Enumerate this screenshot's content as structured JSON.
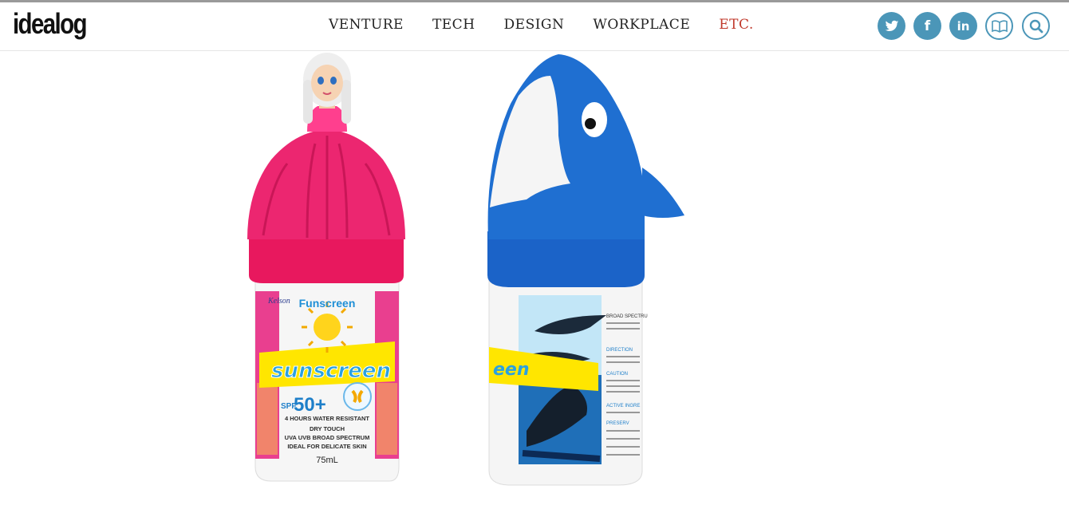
{
  "site": {
    "logo": "idealog"
  },
  "nav": {
    "items": [
      {
        "label": "VENTURE"
      },
      {
        "label": "TECH"
      },
      {
        "label": "DESIGN"
      },
      {
        "label": "WORKPLACE"
      },
      {
        "label": "ETC."
      }
    ],
    "active_index": 4
  },
  "social": [
    {
      "icon": "twitter-icon"
    },
    {
      "icon": "facebook-icon",
      "glyph": "f"
    },
    {
      "icon": "linkedin-icon",
      "glyph": "in"
    },
    {
      "icon": "magazine-icon"
    },
    {
      "icon": "search-icon"
    }
  ],
  "colors": {
    "accent": "#4b96b8",
    "active_nav": "#c0392b",
    "princess_pink": "#e8185e",
    "shark_blue": "#1f6fd1"
  },
  "product_left": {
    "brand": "Funscreen",
    "name": "sunscreen",
    "maker": "Kelson",
    "spf": "SPF",
    "spf_value": "50+",
    "badge": "PARABEN & PRESERVATIVE FREE",
    "features": [
      "4 HOURS WATER RESISTANT",
      "DRY TOUCH",
      "UVA UVB BROAD SPECTRUM",
      "IDEAL FOR DELICATE SKIN"
    ],
    "volume": "75mL"
  },
  "product_right": {
    "name_fragment": "een",
    "label_fragments": [
      "DIRECTION",
      "CAUTION",
      "ACTIVE INGRE",
      "PRESERV",
      "BROAD SPECTRU"
    ]
  }
}
